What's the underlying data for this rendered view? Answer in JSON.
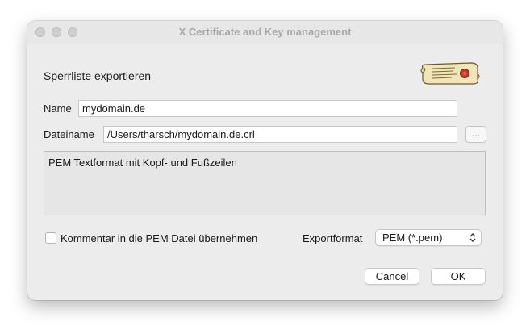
{
  "window": {
    "title": "X Certificate and Key management"
  },
  "dialog": {
    "heading": "Sperrliste exportieren",
    "logo_icon": "certificate-scroll-icon"
  },
  "fields": {
    "name_label": "Name",
    "name_value": "mydomain.de",
    "filename_label": "Dateiname",
    "filename_value": "/Users/tharsch/mydomain.de.crl",
    "browse_label": "..."
  },
  "description": {
    "text": "PEM Textformat mit Kopf- und Fußzeilen"
  },
  "options": {
    "comment_checkbox_label": "Kommentar in die PEM Datei übernehmen",
    "comment_checked": false,
    "export_format_label": "Exportformat",
    "export_format_value": "PEM (*.pem)"
  },
  "buttons": {
    "cancel": "Cancel",
    "ok": "OK"
  }
}
